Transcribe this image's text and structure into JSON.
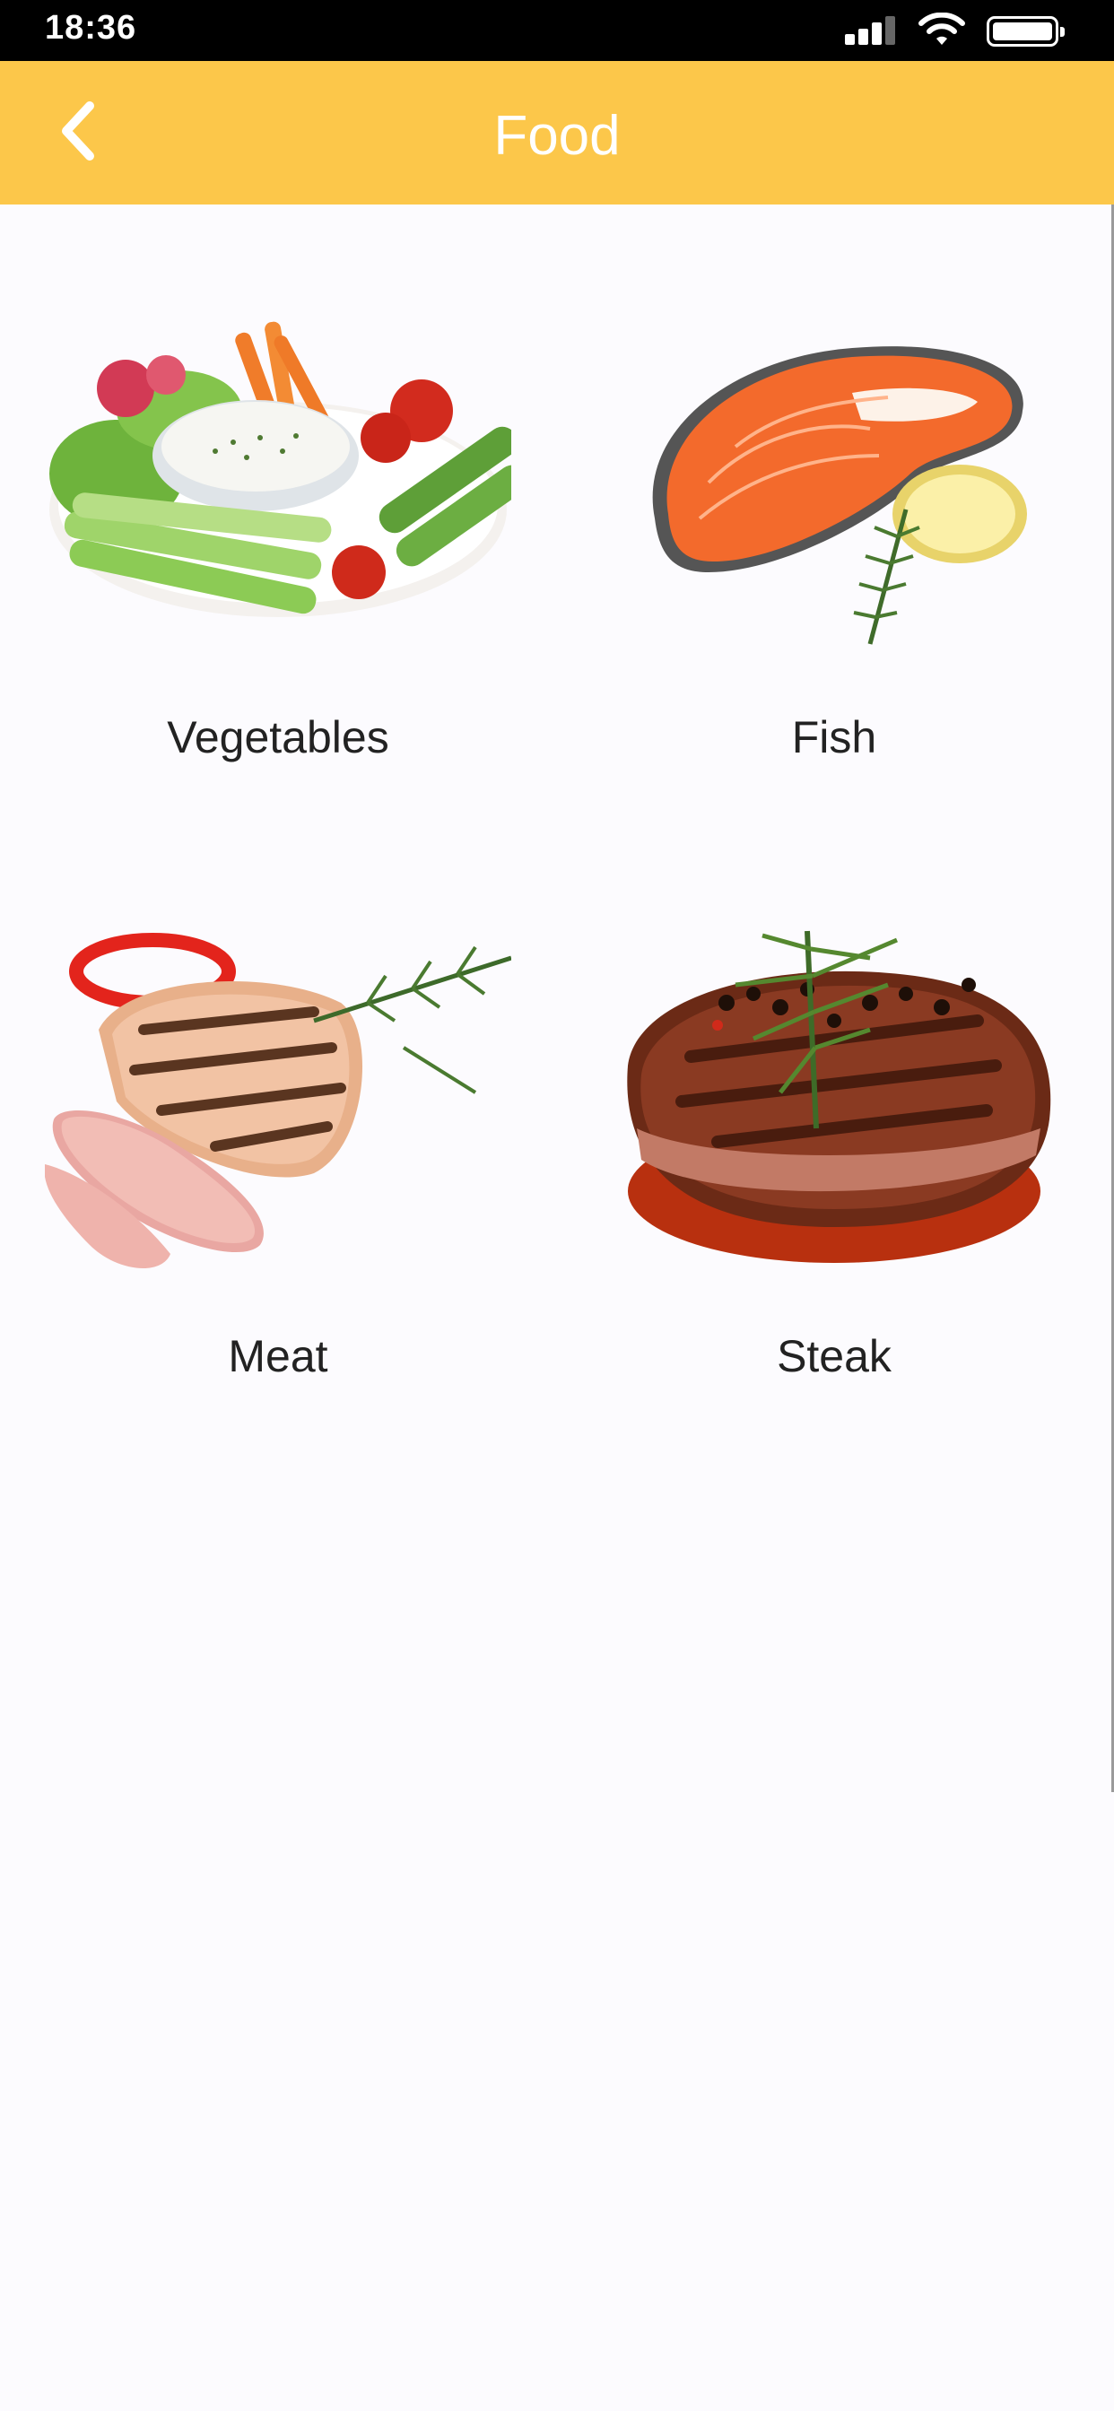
{
  "status_bar": {
    "time": "18:36"
  },
  "nav": {
    "title": "Food",
    "back_icon": "chevron-left-icon",
    "background": "#fcc74a"
  },
  "items": [
    {
      "label": "Vegetables",
      "image": "vegetable-platter-image"
    },
    {
      "label": "Fish",
      "image": "salmon-steak-image"
    },
    {
      "label": "Meat",
      "image": "grilled-meat-image"
    },
    {
      "label": "Steak",
      "image": "beef-steak-image"
    }
  ]
}
